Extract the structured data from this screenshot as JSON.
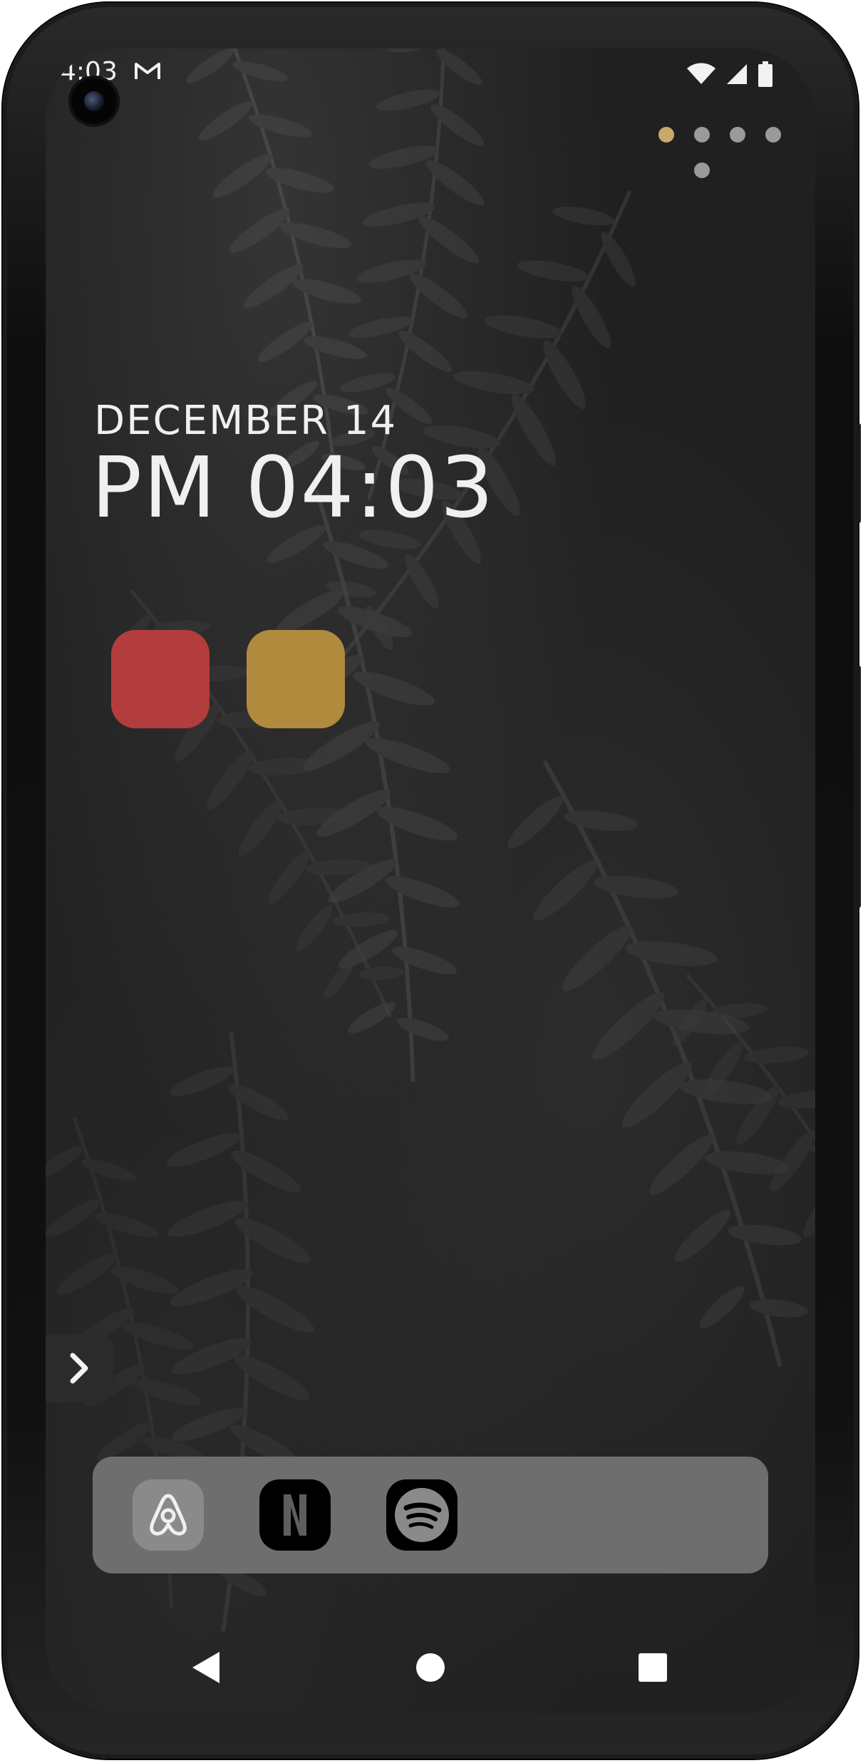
{
  "statusbar": {
    "time": "4:03",
    "notification_icon": "gmail-icon",
    "wifi_icon": "wifi-icon",
    "signal_icon": "cell-signal-icon",
    "battery_icon": "battery-icon"
  },
  "pager": {
    "pages": 5,
    "active_page": 1,
    "active_color": "#c9a86a",
    "inactive_color": "#9a9a9a"
  },
  "clock_widget": {
    "date": "DECEMBER 14",
    "time": "PM 04:03"
  },
  "home_apps": [
    {
      "name": "red-app",
      "color": "#b33d3d"
    },
    {
      "name": "gold-app",
      "color": "#b08a3d"
    }
  ],
  "drawer_handle": {
    "icon": "chevron-right-icon"
  },
  "dock": {
    "background": "#6e6e6e",
    "apps": [
      {
        "name": "Airbnb",
        "icon": "airbnb-icon"
      },
      {
        "name": "Netflix",
        "icon": "netflix-icon"
      },
      {
        "name": "Spotify",
        "icon": "spotify-icon"
      }
    ]
  },
  "navbar": {
    "back_icon": "back-triangle-icon",
    "home_icon": "home-circle-icon",
    "recents_icon": "recents-square-icon"
  }
}
